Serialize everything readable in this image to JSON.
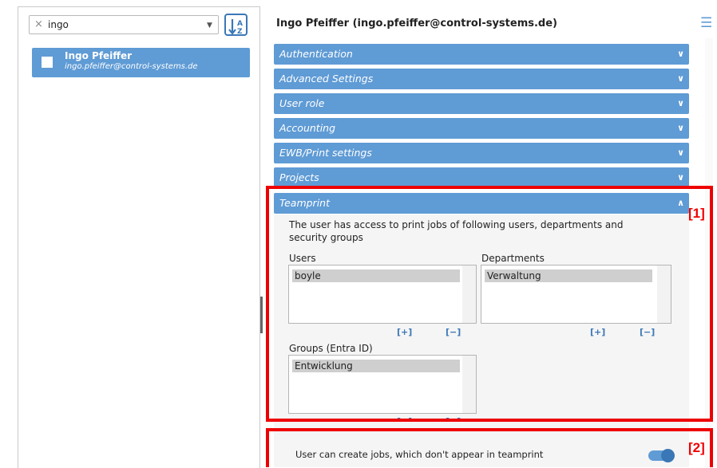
{
  "search": {
    "clear": "×",
    "value": "ingo",
    "caret": "▼"
  },
  "user_list": [
    {
      "name": "Ingo Pfeiffer",
      "email": "ingo.pfeiffer@control-systems.de"
    }
  ],
  "page_title": "Ingo Pfeiffer (ingo.pfeiffer@control-systems.de)",
  "sections": [
    {
      "label": "Authentication",
      "chevron": "⌄"
    },
    {
      "label": "Advanced Settings",
      "chevron": "⌄"
    },
    {
      "label": "User role",
      "chevron": "⌄"
    },
    {
      "label": "Accounting",
      "chevron": "⌄"
    },
    {
      "label": "EWB/Print settings",
      "chevron": "⌄"
    },
    {
      "label": "Projects",
      "chevron": "⌄"
    },
    {
      "label": "Teamprint",
      "chevron": "^"
    }
  ],
  "teamprint": {
    "description": "The user has access to print jobs of following users, departments and security groups",
    "users_label": "Users",
    "users": [
      "boyle"
    ],
    "departments_label": "Departments",
    "departments": [
      "Verwaltung"
    ],
    "groups_label": "Groups (Entra ID)",
    "groups": [
      "Entwicklung"
    ],
    "add_label": "[+]",
    "remove_label": "[−]",
    "toggle_label": "User can create jobs, which don't appear in teamprint",
    "toggle_on": true
  },
  "annotations": {
    "mark1": "[1]",
    "mark2": "[2]"
  },
  "colors": {
    "accent": "#5f9bd5",
    "accent_dark": "#3a77b6",
    "highlight": "#e00000"
  }
}
